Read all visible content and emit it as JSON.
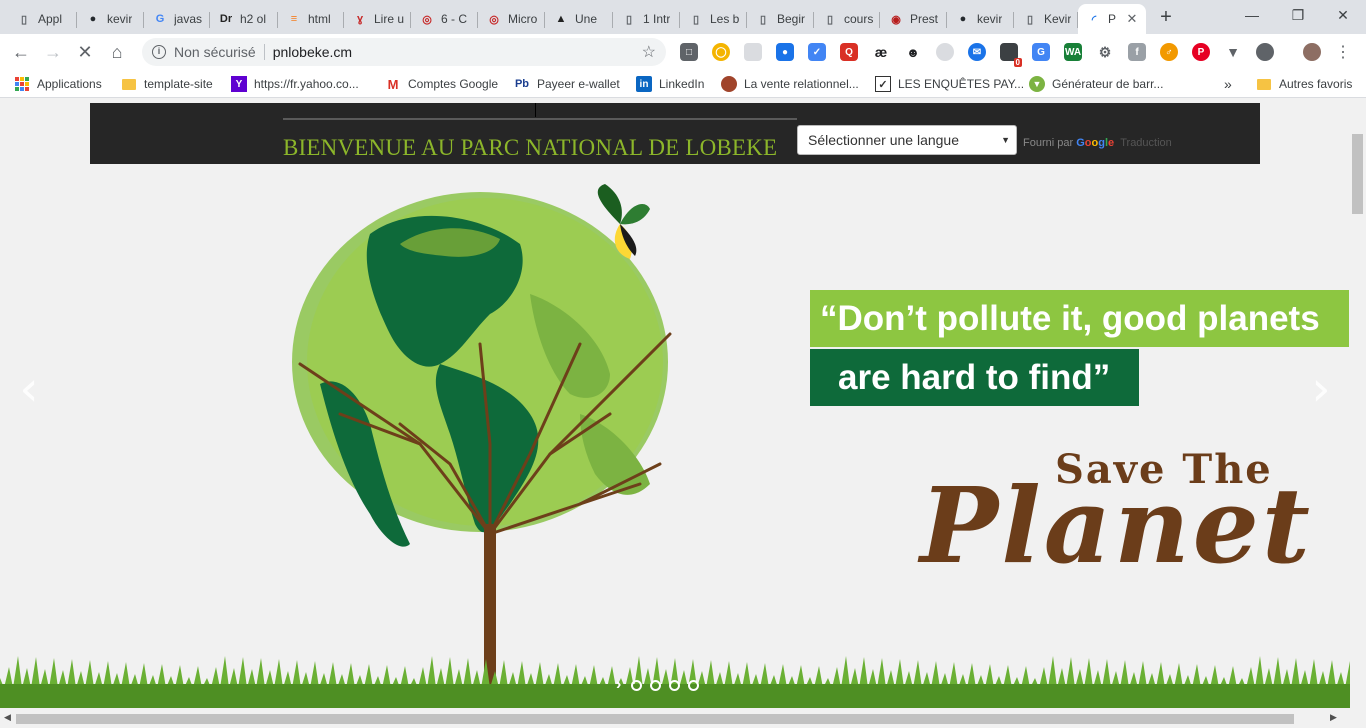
{
  "browser": {
    "tabs": [
      {
        "title": "Appl",
        "icon": "page-icon"
      },
      {
        "title": "kevir",
        "icon": "github-icon"
      },
      {
        "title": "javas",
        "icon": "google-icon"
      },
      {
        "title": "h2 ol",
        "icon": "dr-icon"
      },
      {
        "title": "html",
        "icon": "stackoverflow-icon"
      },
      {
        "title": "Lire u",
        "icon": "feather-icon"
      },
      {
        "title": "6 - C",
        "icon": "openclassrooms-icon"
      },
      {
        "title": "Micro",
        "icon": "openclassrooms-icon"
      },
      {
        "title": "Une",
        "icon": "graduation-cap-icon"
      },
      {
        "title": "1 Intr",
        "icon": "page-icon"
      },
      {
        "title": "Les b",
        "icon": "page-icon"
      },
      {
        "title": "Begir",
        "icon": "page-icon"
      },
      {
        "title": "cours",
        "icon": "page-icon"
      },
      {
        "title": "Prest",
        "icon": "presto-icon"
      },
      {
        "title": "kevir",
        "icon": "github-icon"
      },
      {
        "title": "Kevir",
        "icon": "page-icon"
      },
      {
        "title": "P",
        "icon": "loading-icon",
        "active": true
      }
    ],
    "new_tab_label": "+",
    "address": {
      "security_label": "Non sécurisé",
      "url": "pnlobeke.cm"
    },
    "bookmarks": [
      {
        "label": "Applications",
        "icon": "apps-grid-icon"
      },
      {
        "label": "template-site",
        "icon": "folder-icon"
      },
      {
        "label": "https://fr.yahoo.co...",
        "icon": "yahoo-icon"
      },
      {
        "label": "Comptes Google",
        "icon": "gmail-icon"
      },
      {
        "label": "Payeer e-wallet",
        "icon": "payeer-icon"
      },
      {
        "label": "LinkedIn",
        "icon": "linkedin-icon"
      },
      {
        "label": "La vente relationnel...",
        "icon": "site-icon"
      },
      {
        "label": "LES ENQUÊTES PAY...",
        "icon": "checklist-icon"
      },
      {
        "label": "Générateur de barr...",
        "icon": "generator-icon"
      }
    ],
    "bookmarks_overflow": "»",
    "other_bookmarks": "Autres favoris",
    "extension_badge": "0"
  },
  "page": {
    "site_title": "BIENVENUE AU PARC NATIONAL DE LOBEKE",
    "language_select": "Sélectionner une langue",
    "powered_by": "Fourni par",
    "powered_brand": "Google",
    "powered_service": "Traduction",
    "slide": {
      "quote_line1": "“Don’t pollute it, good planets",
      "quote_line2": "are hard to find”",
      "save_the": "Save The",
      "planet": "Planet",
      "prev_label": "‹",
      "next_label": "›",
      "indicator_count": 4
    }
  },
  "colors": {
    "header_band": "#262626",
    "title_green": "#8cb62a",
    "quote_light_green": "#8dc641",
    "quote_dark_green": "#0e6a3a",
    "planet_brown": "#6b3d1a"
  }
}
